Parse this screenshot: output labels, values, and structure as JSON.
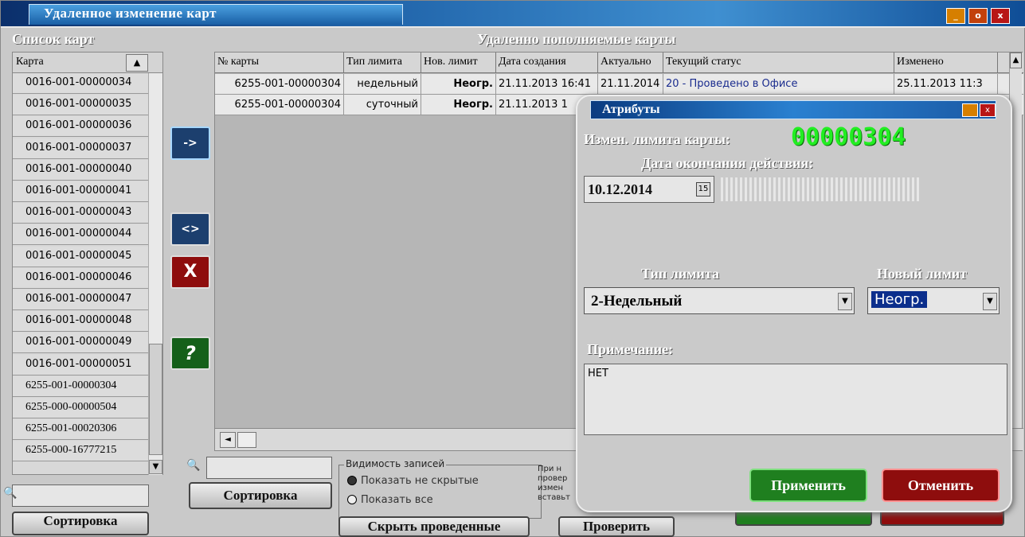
{
  "window": {
    "title": "Удаленное изменение карт",
    "btn_min": "_",
    "btn_max": "o",
    "btn_close": "x"
  },
  "left": {
    "heading": "Список карт",
    "column": "Карта",
    "sort_arrow": "▲",
    "items": [
      "0016-001-00000034",
      "0016-001-00000035",
      "0016-001-00000036",
      "0016-001-00000037",
      "0016-001-00000040",
      "0016-001-00000041",
      "0016-001-00000043",
      "0016-001-00000044",
      "0016-001-00000045",
      "0016-001-00000046",
      "0016-001-00000047",
      "0016-001-00000048",
      "0016-001-00000049",
      "0016-001-00000051",
      "6255-001-00000304",
      "6255-000-00000504",
      "6255-001-00020306",
      "6255-000-16777215"
    ],
    "search_icon": "🔍",
    "sort_button": "Сортировка",
    "scroll_down": "▼"
  },
  "side_buttons": {
    "add": "->",
    "swap": "<>",
    "delete": "X",
    "help": "?"
  },
  "main": {
    "heading": "Удаленно пополняемые карты",
    "columns": [
      "№ карты",
      "Тип лимита",
      "Нов. лимит",
      "Дата создания",
      "Актуально",
      "Текущий статус",
      "Изменено"
    ],
    "rows": [
      [
        "6255-001-00000304",
        "недельный",
        "Неогр.",
        "21.11.2013 16:41",
        "21.11.2014",
        "20 - Проведено в Офисе",
        "25.11.2013 11:3"
      ],
      [
        "6255-001-00000304",
        "суточный",
        "Неогр.",
        "21.11.2013 1",
        "",
        "",
        ""
      ]
    ],
    "sort_arrow": "▲",
    "hscroll_left": "◄"
  },
  "bottom": {
    "search_icon": "🔍",
    "sort_button": "Сортировка",
    "visibility_legend": "Видимость записей",
    "radio_not_hidden": "Показать не скрытые",
    "radio_all": "Показать все",
    "hide_done_button": "Скрыть проведенные",
    "hint_lines": [
      "При н",
      "провер",
      "измен",
      "вставьт"
    ],
    "check_button": "Проверить"
  },
  "dialog": {
    "title": "Атрибуты",
    "card_label": "Измен. лимита карты:",
    "card_number": "00000304",
    "end_date_label": "Дата окончания действия:",
    "end_date": "10.12.2014",
    "calendar_icon": "15",
    "limit_type_label": "Тип лимита",
    "limit_type_value": "2-Недельный",
    "new_limit_label": "Новый лимит",
    "new_limit_value": "Неогр.",
    "note_label": "Примечание:",
    "note_value": "НЕТ",
    "apply_button": "Применить",
    "cancel_button": "Отменить",
    "dropdown_arrow": "▼"
  }
}
